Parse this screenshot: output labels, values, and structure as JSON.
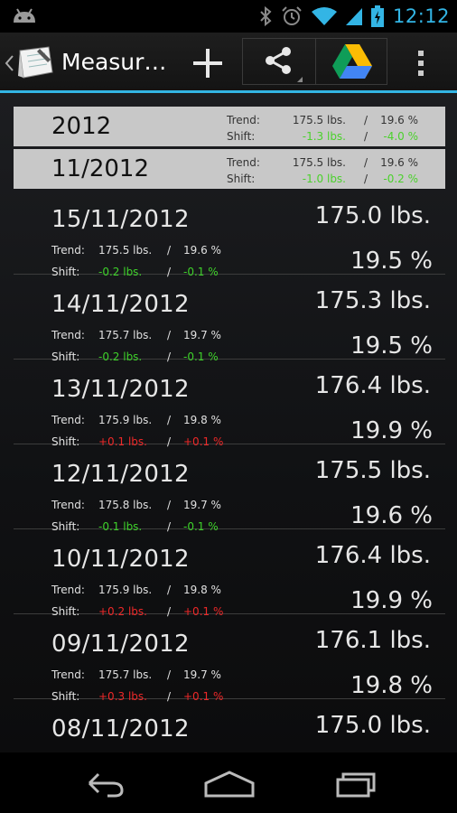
{
  "status_bar": {
    "time": "12:12",
    "icons": [
      "android-debug-icon",
      "bluetooth-icon",
      "alarm-icon",
      "wifi-icon",
      "cell-signal-icon",
      "battery-charging-icon"
    ],
    "accent_color": "#33b5e5"
  },
  "action_bar": {
    "title": "Measur…",
    "icons": [
      "back-chevron-icon",
      "notebook-app-icon",
      "add-icon",
      "share-icon",
      "google-drive-icon",
      "overflow-menu-icon"
    ]
  },
  "summary": [
    {
      "date": "2012",
      "trend_label": "Trend:",
      "trend_weight": "175.5 lbs.",
      "trend_fat": "19.6 %",
      "shift_label": "Shift:",
      "shift_weight": "-1.3 lbs.",
      "shift_fat": "-4.0 %",
      "separator": "/"
    },
    {
      "date": "11/2012",
      "trend_label": "Trend:",
      "trend_weight": "175.5 lbs.",
      "trend_fat": "19.6 %",
      "shift_label": "Shift:",
      "shift_weight": "-1.0 lbs.",
      "shift_fat": "-0.2 %",
      "separator": "/"
    }
  ],
  "entries": [
    {
      "date": "15/11/2012",
      "weight": "175.0 lbs.",
      "fat": "19.5 %",
      "trend_label": "Trend:",
      "trend_weight": "175.5 lbs.",
      "trend_fat": "19.6 %",
      "shift_label": "Shift:",
      "shift_weight": "-0.2 lbs.",
      "shift_fat": "-0.1 %",
      "shift_dir": "neg",
      "separator": "/"
    },
    {
      "date": "14/11/2012",
      "weight": "175.3 lbs.",
      "fat": "19.5 %",
      "trend_label": "Trend:",
      "trend_weight": "175.7 lbs.",
      "trend_fat": "19.7 %",
      "shift_label": "Shift:",
      "shift_weight": "-0.2 lbs.",
      "shift_fat": "-0.1 %",
      "shift_dir": "neg",
      "separator": "/"
    },
    {
      "date": "13/11/2012",
      "weight": "176.4 lbs.",
      "fat": "19.9 %",
      "trend_label": "Trend:",
      "trend_weight": "175.9 lbs.",
      "trend_fat": "19.8 %",
      "shift_label": "Shift:",
      "shift_weight": "+0.1 lbs.",
      "shift_fat": "+0.1 %",
      "shift_dir": "pos",
      "separator": "/"
    },
    {
      "date": "12/11/2012",
      "weight": "175.5 lbs.",
      "fat": "19.6 %",
      "trend_label": "Trend:",
      "trend_weight": "175.8 lbs.",
      "trend_fat": "19.7 %",
      "shift_label": "Shift:",
      "shift_weight": "-0.1 lbs.",
      "shift_fat": "-0.1 %",
      "shift_dir": "neg",
      "separator": "/"
    },
    {
      "date": "10/11/2012",
      "weight": "176.4 lbs.",
      "fat": "19.9 %",
      "trend_label": "Trend:",
      "trend_weight": "175.9 lbs.",
      "trend_fat": "19.8 %",
      "shift_label": "Shift:",
      "shift_weight": "+0.2 lbs.",
      "shift_fat": "+0.1 %",
      "shift_dir": "pos",
      "separator": "/"
    },
    {
      "date": "09/11/2012",
      "weight": "176.1 lbs.",
      "fat": "19.8 %",
      "trend_label": "Trend:",
      "trend_weight": "175.7 lbs.",
      "trend_fat": "19.7 %",
      "shift_label": "Shift:",
      "shift_weight": "+0.3 lbs.",
      "shift_fat": "+0.1 %",
      "shift_dir": "pos",
      "separator": "/"
    },
    {
      "date": "08/11/2012",
      "weight": "175.0 lbs."
    }
  ],
  "colors": {
    "positive_shift": "#ee2828",
    "negative_shift": "#3ed12a",
    "header_background": "#c8c8c8"
  },
  "nav_bar": {
    "icons": [
      "back-icon",
      "home-icon",
      "recent-apps-icon"
    ]
  }
}
